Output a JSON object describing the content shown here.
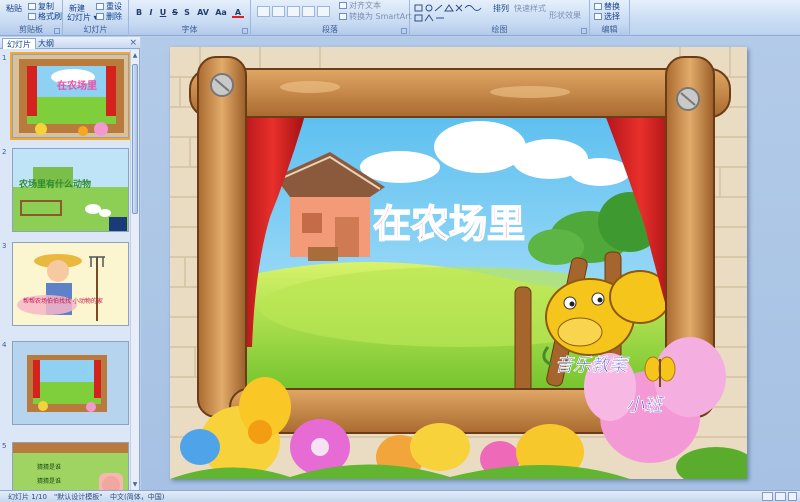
{
  "ribbon": {
    "clipboard": {
      "label": "剪贴板",
      "paste": "粘贴",
      "copy": "复制",
      "format_painter": "格式刷"
    },
    "slides": {
      "label": "幻灯片",
      "new_slide": "新建",
      "new_slide_2": "幻灯片",
      "reset": "重设",
      "delete": "删除"
    },
    "font": {
      "label": "字体",
      "bold": "B",
      "italic": "I",
      "underline": "U",
      "strike": "S",
      "shadow": "S",
      "spacing": "AV",
      "case": "Aa",
      "color": "A"
    },
    "paragraph": {
      "label": "段落",
      "text_box": "对齐文本",
      "smartart": "转换为 SmartArt"
    },
    "drawing": {
      "label": "绘图",
      "arrange": "排列",
      "quick_styles": "快速样式",
      "shape_effects": "形状效果"
    },
    "editing": {
      "label": "编辑",
      "replace": "替换",
      "select": "选择"
    }
  },
  "left_pane": {
    "tab_slides": "幻灯片",
    "tab_outline": "大纲",
    "close": "×",
    "slide_numbers": [
      "1",
      "2",
      "3",
      "4",
      "5"
    ],
    "slide2_text": "农场里有什么动物",
    "slide3_text": "帮帮农场伯伯找找 小动物的家",
    "slide5_text": "猜猜是谁"
  },
  "slide": {
    "title": "在农场里",
    "subtitle": "音乐教案",
    "subtitle2": "小班"
  },
  "status": {
    "slide_position": "幻灯片 1/10",
    "theme": "\"默认设计模板\"",
    "language": "中文(简体，中国)"
  },
  "colors": {
    "ribbon": "#c9dcf3",
    "selection": "#f6a72d",
    "title_pink": "#ee4fa9",
    "subtitle_blue": "#2a3fcf"
  }
}
